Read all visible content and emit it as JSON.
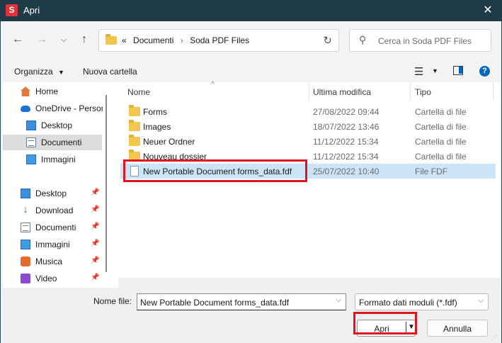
{
  "window": {
    "title": "Apri",
    "app_icon_letter": "S",
    "accent_color": "#e0303a",
    "titlebar_color": "#1f3b47"
  },
  "nav": {
    "back_icon": "arrow-left-icon",
    "forward_icon": "arrow-right-icon",
    "recent_icon": "chevron-down-icon",
    "up_icon": "arrow-up-icon",
    "address": {
      "overflow": "«",
      "crumbs": [
        "Documenti",
        "Soda PDF Files"
      ],
      "separator": "›"
    },
    "search_placeholder": "Cerca in Soda PDF Files"
  },
  "toolbar": {
    "organize_label": "Organizza",
    "new_folder_label": "Nuova cartella",
    "help_label": "?"
  },
  "sidebar": {
    "top_items": [
      {
        "label": "Home",
        "icon": "home-icon"
      },
      {
        "label": "OneDrive - Person",
        "icon": "cloud-icon"
      },
      {
        "label": "Desktop",
        "icon": "desktop-icon"
      },
      {
        "label": "Documenti",
        "icon": "documents-icon",
        "selected": true
      },
      {
        "label": "Immagini",
        "icon": "pictures-icon"
      }
    ],
    "quick_items": [
      {
        "label": "Desktop",
        "icon": "desktop-icon"
      },
      {
        "label": "Download",
        "icon": "download-icon"
      },
      {
        "label": "Documenti",
        "icon": "documents-icon"
      },
      {
        "label": "Immagini",
        "icon": "pictures-icon"
      },
      {
        "label": "Musica",
        "icon": "music-icon"
      },
      {
        "label": "Video",
        "icon": "video-icon"
      }
    ]
  },
  "filelist": {
    "columns": [
      "Nome",
      "Ultima modifica",
      "Tipo"
    ],
    "rows": [
      {
        "name": "Forms",
        "modified": "27/08/2022 09:44",
        "type": "Cartella di file",
        "kind": "folder"
      },
      {
        "name": "Images",
        "modified": "18/07/2022 13:46",
        "type": "Cartella di file",
        "kind": "folder"
      },
      {
        "name": "Neuer Ordner",
        "modified": "11/12/2022 15:34",
        "type": "Cartella di file",
        "kind": "folder"
      },
      {
        "name": "Nouveau dossier",
        "modified": "11/12/2022 15:34",
        "type": "Cartella di file",
        "kind": "folder"
      },
      {
        "name": "New Portable Document forms_data.fdf",
        "modified": "25/07/2022 10:40",
        "type": "File FDF",
        "kind": "file",
        "selected": true
      }
    ]
  },
  "footer": {
    "filename_label": "Nome file:",
    "filename_value": "New Portable Document forms_data.fdf",
    "filetype_value": "Formato dati moduli (*.fdf)",
    "open_label": "Apri",
    "cancel_label": "Annulla"
  },
  "highlight_color": "#e0141e"
}
